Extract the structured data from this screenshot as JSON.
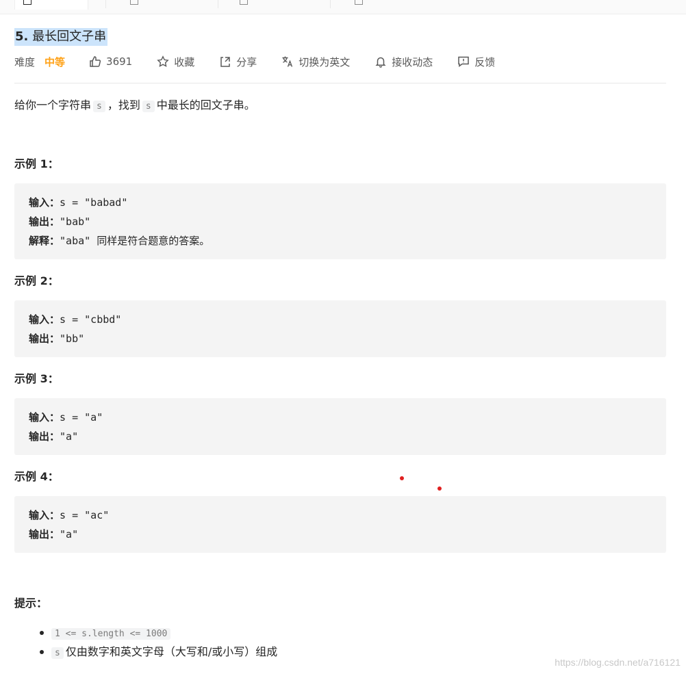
{
  "problem": {
    "title_number": "5.",
    "title_text": "最长回文子串",
    "difficulty_label": "难度",
    "difficulty": "中等",
    "likes": "3691",
    "favorite_label": "收藏",
    "share_label": "分享",
    "switch_lang_label": "切换为英文",
    "subscribe_label": "接收动态",
    "feedback_label": "反馈"
  },
  "description": {
    "part1": "给你一个字符串",
    "var1": "s",
    "part2": "，找到",
    "var2": "s",
    "part3": "中最长的回文子串。"
  },
  "examples": [
    {
      "title": "示例 1：",
      "lines": [
        {
          "key": "输入：",
          "value": "s = \"babad\""
        },
        {
          "key": "输出：",
          "value": "\"bab\""
        },
        {
          "key": "解释：",
          "value": "\"aba\" 同样是符合题意的答案。"
        }
      ]
    },
    {
      "title": "示例 2：",
      "lines": [
        {
          "key": "输入：",
          "value": "s = \"cbbd\""
        },
        {
          "key": "输出：",
          "value": "\"bb\""
        }
      ]
    },
    {
      "title": "示例 3：",
      "lines": [
        {
          "key": "输入：",
          "value": "s = \"a\""
        },
        {
          "key": "输出：",
          "value": "\"a\""
        }
      ]
    },
    {
      "title": "示例 4：",
      "lines": [
        {
          "key": "输入：",
          "value": "s = \"ac\""
        },
        {
          "key": "输出：",
          "value": "\"a\""
        }
      ]
    }
  ],
  "hints": {
    "title": "提示：",
    "items": [
      {
        "code": "1 <= s.length <= 1000",
        "text": ""
      },
      {
        "code": "s",
        "text": "仅由数字和英文字母（大写和/或小写）组成"
      }
    ]
  },
  "watermark": "https://blog.csdn.net/a716121",
  "colors": {
    "difficulty_medium": "#ffa116",
    "title_highlight": "#cce4fb",
    "code_bg": "#f4f4f4",
    "marker_dot": "#e02020"
  }
}
